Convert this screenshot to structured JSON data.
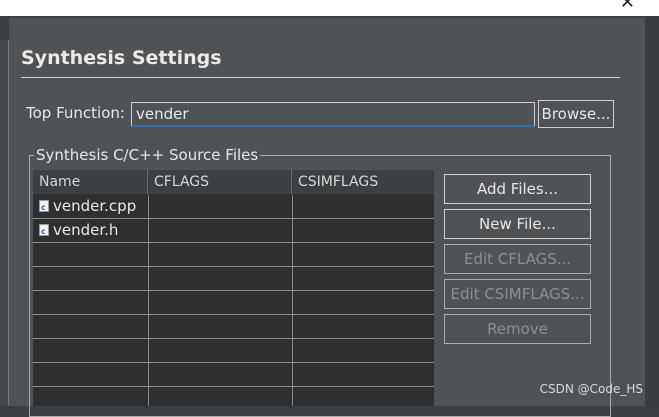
{
  "window": {
    "close_glyph": "✕"
  },
  "section": {
    "title": "Synthesis Settings"
  },
  "top_function": {
    "label": "Top Function:",
    "value": "vender",
    "browse_label": "Browse..."
  },
  "source_files": {
    "group_label": "Synthesis C/C++ Source Files",
    "columns": [
      "Name",
      "CFLAGS",
      "CSIMFLAGS"
    ],
    "rows": [
      {
        "name": "vender.cpp",
        "cflags": "",
        "csimflags": ""
      },
      {
        "name": "vender.h",
        "cflags": "",
        "csimflags": ""
      }
    ]
  },
  "actions": {
    "add_files": "Add Files...",
    "new_file": "New File...",
    "edit_cflags": "Edit CFLAGS...",
    "edit_csimflags": "Edit CSIMFLAGS...",
    "remove": "Remove"
  },
  "watermark": "CSDN @Code_HS"
}
